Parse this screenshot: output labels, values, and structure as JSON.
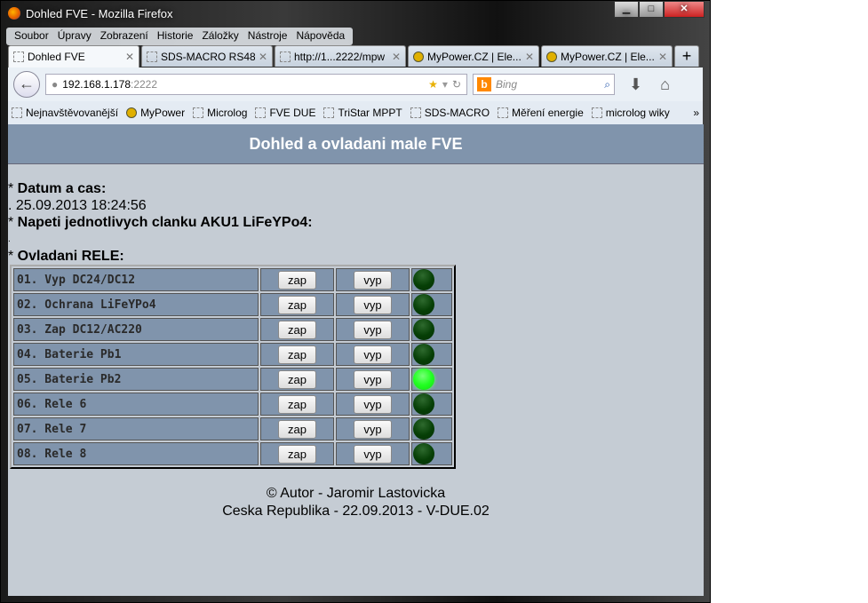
{
  "window": {
    "title": "Dohled FVE - Mozilla Firefox"
  },
  "menu": [
    "Soubor",
    "Úpravy",
    "Zobrazení",
    "Historie",
    "Záložky",
    "Nástroje",
    "Nápověda"
  ],
  "tabs": [
    {
      "label": "Dohled FVE",
      "icon": "blank"
    },
    {
      "label": "SDS-MACRO RS48...",
      "icon": "sds"
    },
    {
      "label": "http://1...2222/mpw",
      "icon": "blank"
    },
    {
      "label": "MyPower.CZ | Ele...",
      "icon": "sun"
    },
    {
      "label": "MyPower.CZ | Ele...",
      "icon": "sun"
    }
  ],
  "nav": {
    "url_host": "192.168.1.178",
    "url_port": ":2222",
    "search_placeholder": "Bing"
  },
  "bookmarks": [
    "Nejnavštěvovanější",
    "MyPower",
    "Microlog",
    "FVE DUE",
    "TriStar MPPT",
    "SDS-MACRO",
    "Měření energie",
    "microlog wiky"
  ],
  "page": {
    "header": "Dohled a ovladani male FVE",
    "date_label": "Datum a cas:",
    "date_value": "25.09.2013 18:24:56",
    "voltage_label": "Napeti jednotlivych clanku AKU1 LiFeYPo4:",
    "relay_label": "Ovladani RELE:",
    "on_label": "zap",
    "off_label": "vyp",
    "relays": [
      {
        "name": "01. Vyp DC24/DC12",
        "on": false
      },
      {
        "name": "02. Ochrana LiFeYPo4",
        "on": false
      },
      {
        "name": "03. Zap DC12/AC220",
        "on": false
      },
      {
        "name": "04. Baterie Pb1",
        "on": false
      },
      {
        "name": "05. Baterie Pb2",
        "on": true
      },
      {
        "name": "06. Rele 6",
        "on": false
      },
      {
        "name": "07. Rele 7",
        "on": false
      },
      {
        "name": "08. Rele 8",
        "on": false
      }
    ],
    "footer1": "© Autor - Jaromir Lastovicka",
    "footer2": "Ceska Republika - 22.09.2013 - V-DUE.02"
  },
  "colors": {
    "header": "#8094ac",
    "background": "#c5ccd4",
    "led_on": "#22ff22",
    "led_off": "#063f06"
  }
}
